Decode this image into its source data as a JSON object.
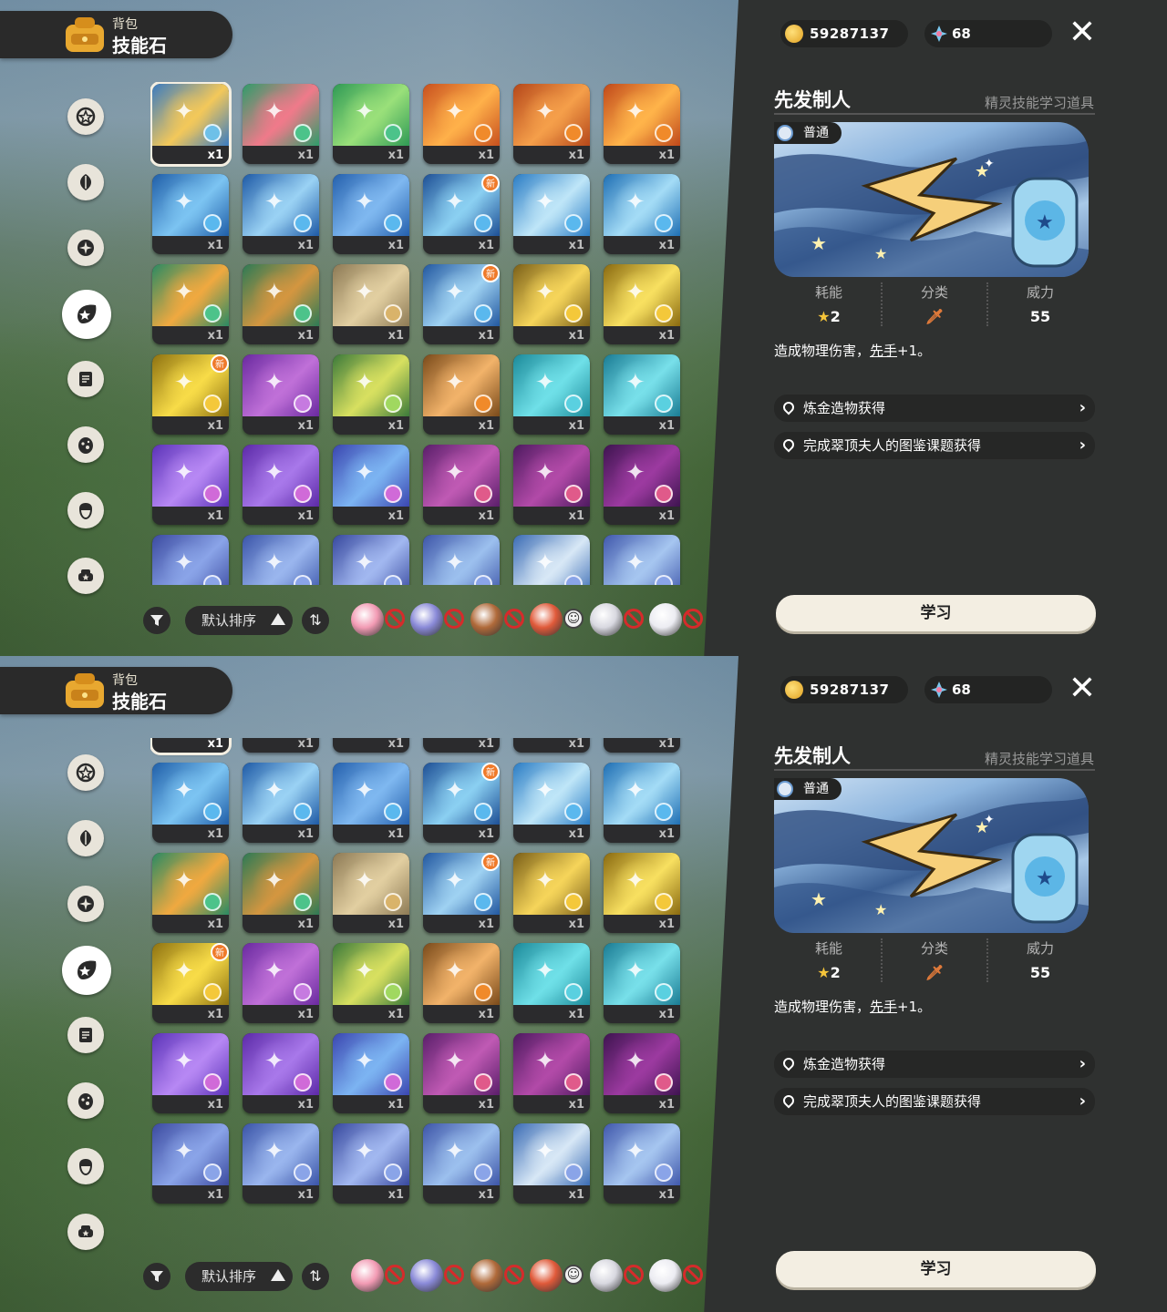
{
  "header": {
    "subtitle": "背包",
    "title": "技能石"
  },
  "currency": {
    "coins": "59287137",
    "gems": "68"
  },
  "sort": {
    "label": "默认排序"
  },
  "detail": {
    "name": "先发制人",
    "category_text": "精灵技能学习道具",
    "rank": "普通",
    "stats": {
      "cost_label": "耗能",
      "cost_value": "2",
      "class_label": "分类",
      "power_label": "威力",
      "power_value": "55"
    },
    "desc_prefix": "造成物理伤害，",
    "desc_link": "先手",
    "desc_suffix": "+1。",
    "sources": [
      "炼金造物获得",
      "完成翠顶夫人的图鉴课题获得"
    ],
    "learn_label": "学习"
  },
  "tiles": [
    {
      "qty": "x1",
      "c1": "#3a7bc0",
      "c2": "#f3c85a",
      "badge": "#6ec0e8",
      "new": false
    },
    {
      "qty": "x1",
      "c1": "#2e9c6a",
      "c2": "#f07a8a",
      "badge": "#4cc38a",
      "new": false
    },
    {
      "qty": "x1",
      "c1": "#2f9a55",
      "c2": "#9ae07a",
      "badge": "#4cc38a",
      "new": false
    },
    {
      "qty": "x1",
      "c1": "#c8501e",
      "c2": "#ffb14a",
      "badge": "#f08a2a",
      "new": false
    },
    {
      "qty": "x1",
      "c1": "#b5471a",
      "c2": "#f59f4a",
      "badge": "#f08a2a",
      "new": false
    },
    {
      "qty": "x1",
      "c1": "#c0481a",
      "c2": "#ffb44a",
      "badge": "#f08a2a",
      "new": false
    },
    {
      "qty": "x1",
      "c1": "#1f5ea8",
      "c2": "#7cc4f2",
      "badge": "#5ab8ee",
      "new": false
    },
    {
      "qty": "x1",
      "c1": "#1e5aa6",
      "c2": "#9ad2f4",
      "badge": "#5ab8ee",
      "new": false
    },
    {
      "qty": "x1",
      "c1": "#2460ad",
      "c2": "#7fb8f0",
      "badge": "#5ab8ee",
      "new": false
    },
    {
      "qty": "x1",
      "c1": "#1d4f95",
      "c2": "#8bd0f2",
      "badge": "#5ab8ee",
      "new": true
    },
    {
      "qty": "x1",
      "c1": "#2a7cc4",
      "c2": "#bfe6f8",
      "badge": "#5ab8ee",
      "new": false
    },
    {
      "qty": "x1",
      "c1": "#1f6fb4",
      "c2": "#a4dcf6",
      "badge": "#5ab8ee",
      "new": false
    },
    {
      "qty": "x1",
      "c1": "#2a8a63",
      "c2": "#f0a940",
      "badge": "#4cc38a",
      "new": false
    },
    {
      "qty": "x1",
      "c1": "#2d7a55",
      "c2": "#d49640",
      "badge": "#4cc38a",
      "new": false
    },
    {
      "qty": "x1",
      "c1": "#8d7a55",
      "c2": "#e2cfa1",
      "badge": "#d9b36a",
      "new": false
    },
    {
      "qty": "x1",
      "c1": "#2258a0",
      "c2": "#9fd2f2",
      "badge": "#5ab8ee",
      "new": true
    },
    {
      "qty": "x1",
      "c1": "#7a5f18",
      "c2": "#f6d55a",
      "badge": "#f4c83a",
      "new": false
    },
    {
      "qty": "x1",
      "c1": "#8a6a10",
      "c2": "#f8e060",
      "badge": "#f4c83a",
      "new": false
    },
    {
      "qty": "x1",
      "c1": "#8e7210",
      "c2": "#f8dc48",
      "badge": "#f4c83a",
      "new": true
    },
    {
      "qty": "x1",
      "c1": "#6a2aa0",
      "c2": "#c070d8",
      "badge": "#c67ae0",
      "new": false
    },
    {
      "qty": "x1",
      "c1": "#3c7a3a",
      "c2": "#d8e060",
      "badge": "#a0d860",
      "new": false
    },
    {
      "qty": "x1",
      "c1": "#7a4a1a",
      "c2": "#f2b36a",
      "badge": "#f08a2a",
      "new": false
    },
    {
      "qty": "x1",
      "c1": "#1c8a9a",
      "c2": "#6fe0e8",
      "badge": "#5ad0e0",
      "new": false
    },
    {
      "qty": "x1",
      "c1": "#1a7c94",
      "c2": "#78e0ea",
      "badge": "#5ad0e0",
      "new": false
    },
    {
      "qty": "x1",
      "c1": "#5b32b8",
      "c2": "#b788f4",
      "badge": "#d06ad8",
      "new": false
    },
    {
      "qty": "x1",
      "c1": "#5c2aa8",
      "c2": "#a878ea",
      "badge": "#d06ad8",
      "new": false
    },
    {
      "qty": "x1",
      "c1": "#3a46b0",
      "c2": "#7cb4f2",
      "badge": "#d06ad8",
      "new": false
    },
    {
      "qty": "x1",
      "c1": "#5a1e6a",
      "c2": "#c05ab4",
      "badge": "#e05a8a",
      "new": false
    },
    {
      "qty": "x1",
      "c1": "#4e1a60",
      "c2": "#b24aa8",
      "badge": "#e05a8a",
      "new": false
    },
    {
      "qty": "x1",
      "c1": "#3e1450",
      "c2": "#9c3aa0",
      "badge": "#e05a8a",
      "new": false
    },
    {
      "qty": "x1",
      "c1": "#3b4aa0",
      "c2": "#8aa4e8",
      "badge": "#8aa4e8",
      "new": false
    },
    {
      "qty": "x1",
      "c1": "#3a54a8",
      "c2": "#9ab6ee",
      "badge": "#8aa4e8",
      "new": false
    },
    {
      "qty": "x1",
      "c1": "#37489e",
      "c2": "#a2b8f0",
      "badge": "#8aa4e8",
      "new": false
    },
    {
      "qty": "x1",
      "c1": "#3d55a8",
      "c2": "#9cc0ee",
      "badge": "#8aa4e8",
      "new": false
    },
    {
      "qty": "x1",
      "c1": "#3a6bb4",
      "c2": "#d8e8f6",
      "badge": "#8aa4e8",
      "new": false
    },
    {
      "qty": "x1",
      "c1": "#4058ac",
      "c2": "#a6c6f0",
      "badge": "#8aa4e8",
      "new": false
    }
  ],
  "new_label": "新",
  "pets": [
    {
      "name": "pink",
      "color": "#f29bb4",
      "state": "ban"
    },
    {
      "name": "dragon",
      "color": "#8a8ad8",
      "state": "ban"
    },
    {
      "name": "brown",
      "color": "#b06a3a",
      "state": "ban"
    },
    {
      "name": "fire",
      "color": "#e05a3a",
      "state": "smile"
    },
    {
      "name": "white",
      "color": "#d8d8e0",
      "state": "ban"
    },
    {
      "name": "rabbit",
      "color": "#ececf2",
      "state": "ban"
    }
  ],
  "colors": {
    "panel": "#2f3130",
    "accent_orange": "#ef7a2a"
  }
}
